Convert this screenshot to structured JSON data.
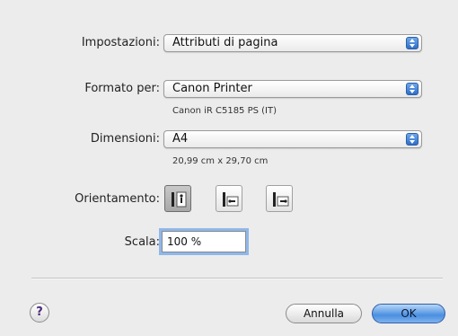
{
  "settings": {
    "label": "Impostazioni:",
    "value": "Attributi di pagina"
  },
  "format": {
    "label": "Formato per:",
    "value": "Canon Printer",
    "sub": "Canon iR C5185 PS (IT)"
  },
  "paper": {
    "label": "Dimensioni:",
    "value": "A4",
    "sub": "20,99 cm x 29,70 cm"
  },
  "orientation": {
    "label": "Orientamento:",
    "options": [
      {
        "name": "portrait",
        "selected": true
      },
      {
        "name": "landscape-left",
        "selected": false
      },
      {
        "name": "landscape-right",
        "selected": false
      }
    ]
  },
  "scale": {
    "label": "Scala:",
    "value": "100 %"
  },
  "buttons": {
    "help": "?",
    "cancel": "Annulla",
    "ok": "OK"
  },
  "colors": {
    "accent": "#4a8fe0",
    "focus": "#8fb7ea",
    "background": "#ececec"
  }
}
